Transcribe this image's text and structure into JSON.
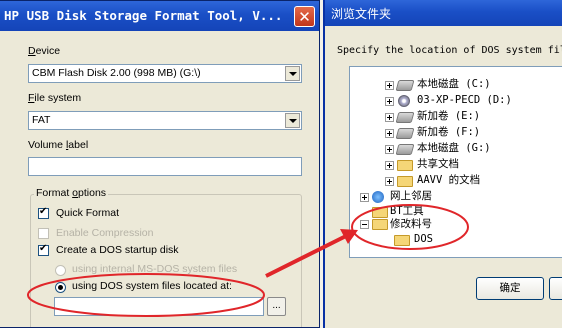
{
  "left_dialog": {
    "title": "HP USB Disk Storage Format Tool, V...",
    "device_label_u": "D",
    "device_label_rest": "evice",
    "device_value": "CBM Flash Disk 2.00 (998 MB) (G:\\)",
    "filesystem_label_u": "F",
    "filesystem_label_rest": "ile system",
    "filesystem_value": "FAT",
    "volume_label_pre": "Volume ",
    "volume_label_u": "l",
    "volume_label_rest": "abel",
    "format_options_pre": "Format ",
    "format_options_u": "o",
    "format_options_rest": "ptions",
    "quick_format": "Quick Format",
    "enable_compression": "Enable Compression",
    "create_dos": "Create a DOS startup disk",
    "using_internal": "using internal MS-DOS system files",
    "using_dos_files": "using DOS system files located at:",
    "browse_button": "..."
  },
  "right_dialog": {
    "title": "浏览文件夹",
    "prompt": "Specify the location of DOS system files",
    "tree": [
      {
        "label": "本地磁盘 (C:)",
        "icon": "drive-icon"
      },
      {
        "label": "03-XP-PECD (D:)",
        "icon": "cdrom-icon"
      },
      {
        "label": "新加卷 (E:)",
        "icon": "drive-icon"
      },
      {
        "label": "新加卷 (F:)",
        "icon": "drive-icon"
      },
      {
        "label": "本地磁盘 (G:)",
        "icon": "drive-icon"
      },
      {
        "label": "共享文档",
        "icon": "folder-icon"
      },
      {
        "label": "AAVV 的文档",
        "icon": "folder-icon"
      },
      {
        "label": "网上邻居",
        "icon": "network-icon"
      },
      {
        "label": "BT工具",
        "icon": "folder-icon"
      },
      {
        "label": "修改料号",
        "icon": "folder-open-icon"
      },
      {
        "label": "DOS",
        "icon": "folder-icon"
      }
    ],
    "ok_button": "确定"
  },
  "colors": {
    "titlebar": "#1a4fc6",
    "annotation": "#e0262a",
    "window_bg": "#ece9d8"
  }
}
